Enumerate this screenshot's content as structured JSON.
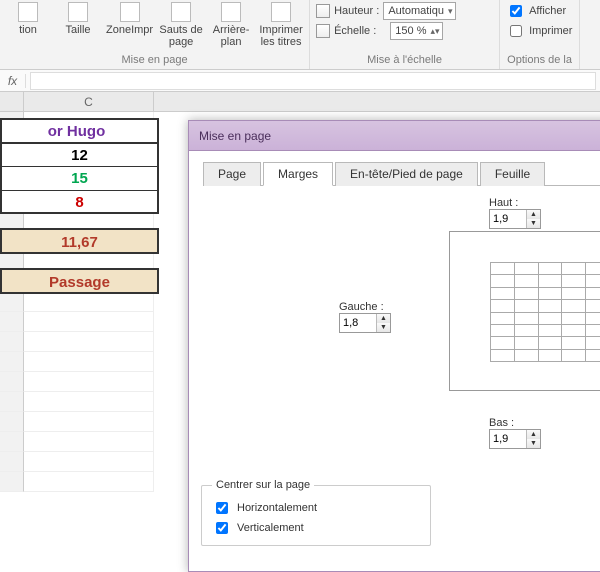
{
  "ribbon": {
    "group_page": {
      "btns": [
        "tion",
        "Taille",
        "ZoneImpr",
        "Sauts de\npage",
        "Arrière-\nplan",
        "Imprimer\nles titres"
      ],
      "label": "Mise en page"
    },
    "group_scale": {
      "height_label": "Hauteur :",
      "height_value": "Automatiqu",
      "scale_label": "Échelle :",
      "scale_value": "150 %",
      "label": "Mise à l'échelle"
    },
    "group_opts": {
      "show": "Afficher",
      "print": "Imprimer",
      "label": "Options de la"
    }
  },
  "formula_bar": {
    "fx": "fx"
  },
  "sheet": {
    "col_c": "C",
    "title": "or Hugo",
    "v1": "12",
    "v2": "15",
    "v3": "8",
    "avg": "11,67",
    "pass": "Passage"
  },
  "dialog": {
    "title": "Mise en page",
    "tabs": [
      "Page",
      "Marges",
      "En-tête/Pied de page",
      "Feuille"
    ],
    "active_tab": 1,
    "top_label": "Haut :",
    "top_value": "1,9",
    "left_label": "Gauche :",
    "left_value": "1,8",
    "bottom_label": "Bas :",
    "bottom_value": "1,9",
    "center_legend": "Centrer sur la page",
    "center_h": "Horizontalement",
    "center_v": "Verticalement",
    "center_h_checked": true,
    "center_v_checked": true
  }
}
